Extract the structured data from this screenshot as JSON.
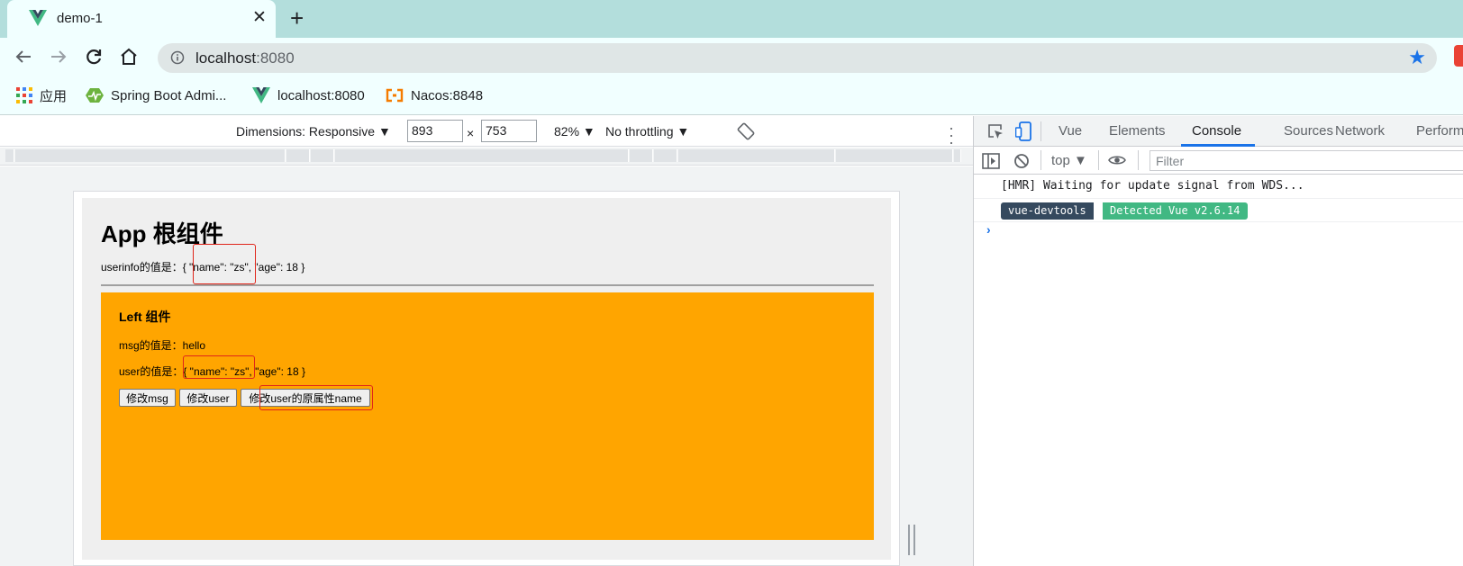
{
  "browser": {
    "tab": {
      "title": "demo-1",
      "close_glyph": "✕"
    },
    "new_tab_glyph": "+",
    "address": {
      "host": "localhost",
      "port": ":8080",
      "star_glyph": "★"
    },
    "bookmarks": [
      {
        "label": "应用",
        "icon": "apps-grid-icon"
      },
      {
        "label": "Spring Boot Admi...",
        "icon": "spring-boot-icon"
      },
      {
        "label": "localhost:8080",
        "icon": "vue-logo-icon"
      },
      {
        "label": "Nacos:8848",
        "icon": "nacos-icon"
      }
    ]
  },
  "device_toolbar": {
    "dimensions_label": "Dimensions: Responsive ▼",
    "width": "893",
    "times": "×",
    "height": "753",
    "zoom": "82% ▼",
    "throttling": "No throttling ▼"
  },
  "app": {
    "title": "App 根组件",
    "userinfo_line": "userinfo的值是：{ \"name\": \"zs\", \"age\": 18 }",
    "left": {
      "title": "Left 组件",
      "msg_line": "msg的值是：hello",
      "user_line": "user的值是：{ \"name\": \"zs\", \"age\": 18 }",
      "buttons": {
        "modify_msg": "修改msg",
        "modify_user": "修改user",
        "modify_user_name": "修改user的原属性name"
      }
    }
  },
  "devtools": {
    "tabs": [
      "Vue",
      "Elements",
      "Console",
      "Sources",
      "Network",
      "Perform"
    ],
    "active_tab": "Console",
    "context": "top ▼",
    "filter_placeholder": "Filter",
    "logs": {
      "hmr": "[HMR] Waiting for update signal from WDS...",
      "badge_left": "vue-devtools",
      "badge_right": "Detected Vue v2.6.14"
    },
    "prompt_glyph": "›"
  },
  "colors": {
    "tab_strip": "#b3dedc",
    "toolbar": "#f1ffff",
    "left_component": "#ffa500",
    "highlight_box": "#e0261b",
    "vue_green": "#41b883",
    "vue_dark": "#35495e",
    "accent_blue": "#1a73e8"
  }
}
